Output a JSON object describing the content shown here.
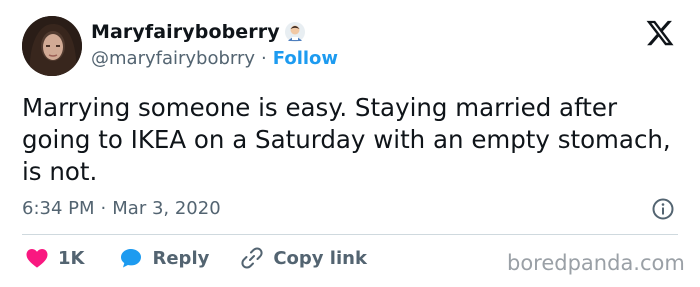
{
  "author": {
    "display_name": "Maryfairyboberry",
    "handle": "@maryfairybobrry",
    "follow_label": "Follow",
    "separator": "·"
  },
  "tweet": {
    "text": "Marrying someone is easy. Staying married after going to IKEA on a Saturday with an empty stomach, is not.",
    "time": "6:34 PM",
    "date": "Mar 3, 2020",
    "separator": "·"
  },
  "actions": {
    "like_count": "1K",
    "reply_label": "Reply",
    "copy_label": "Copy link"
  },
  "watermark": "boredpanda.com",
  "colors": {
    "like": "#f91880",
    "reply": "#1d9bf0",
    "follow": "#1d9bf0",
    "secondary_text": "#536471"
  },
  "icons": [
    "x-logo-icon",
    "info-icon",
    "heart-icon",
    "reply-bubble-icon",
    "link-icon",
    "person-emoji-icon"
  ]
}
